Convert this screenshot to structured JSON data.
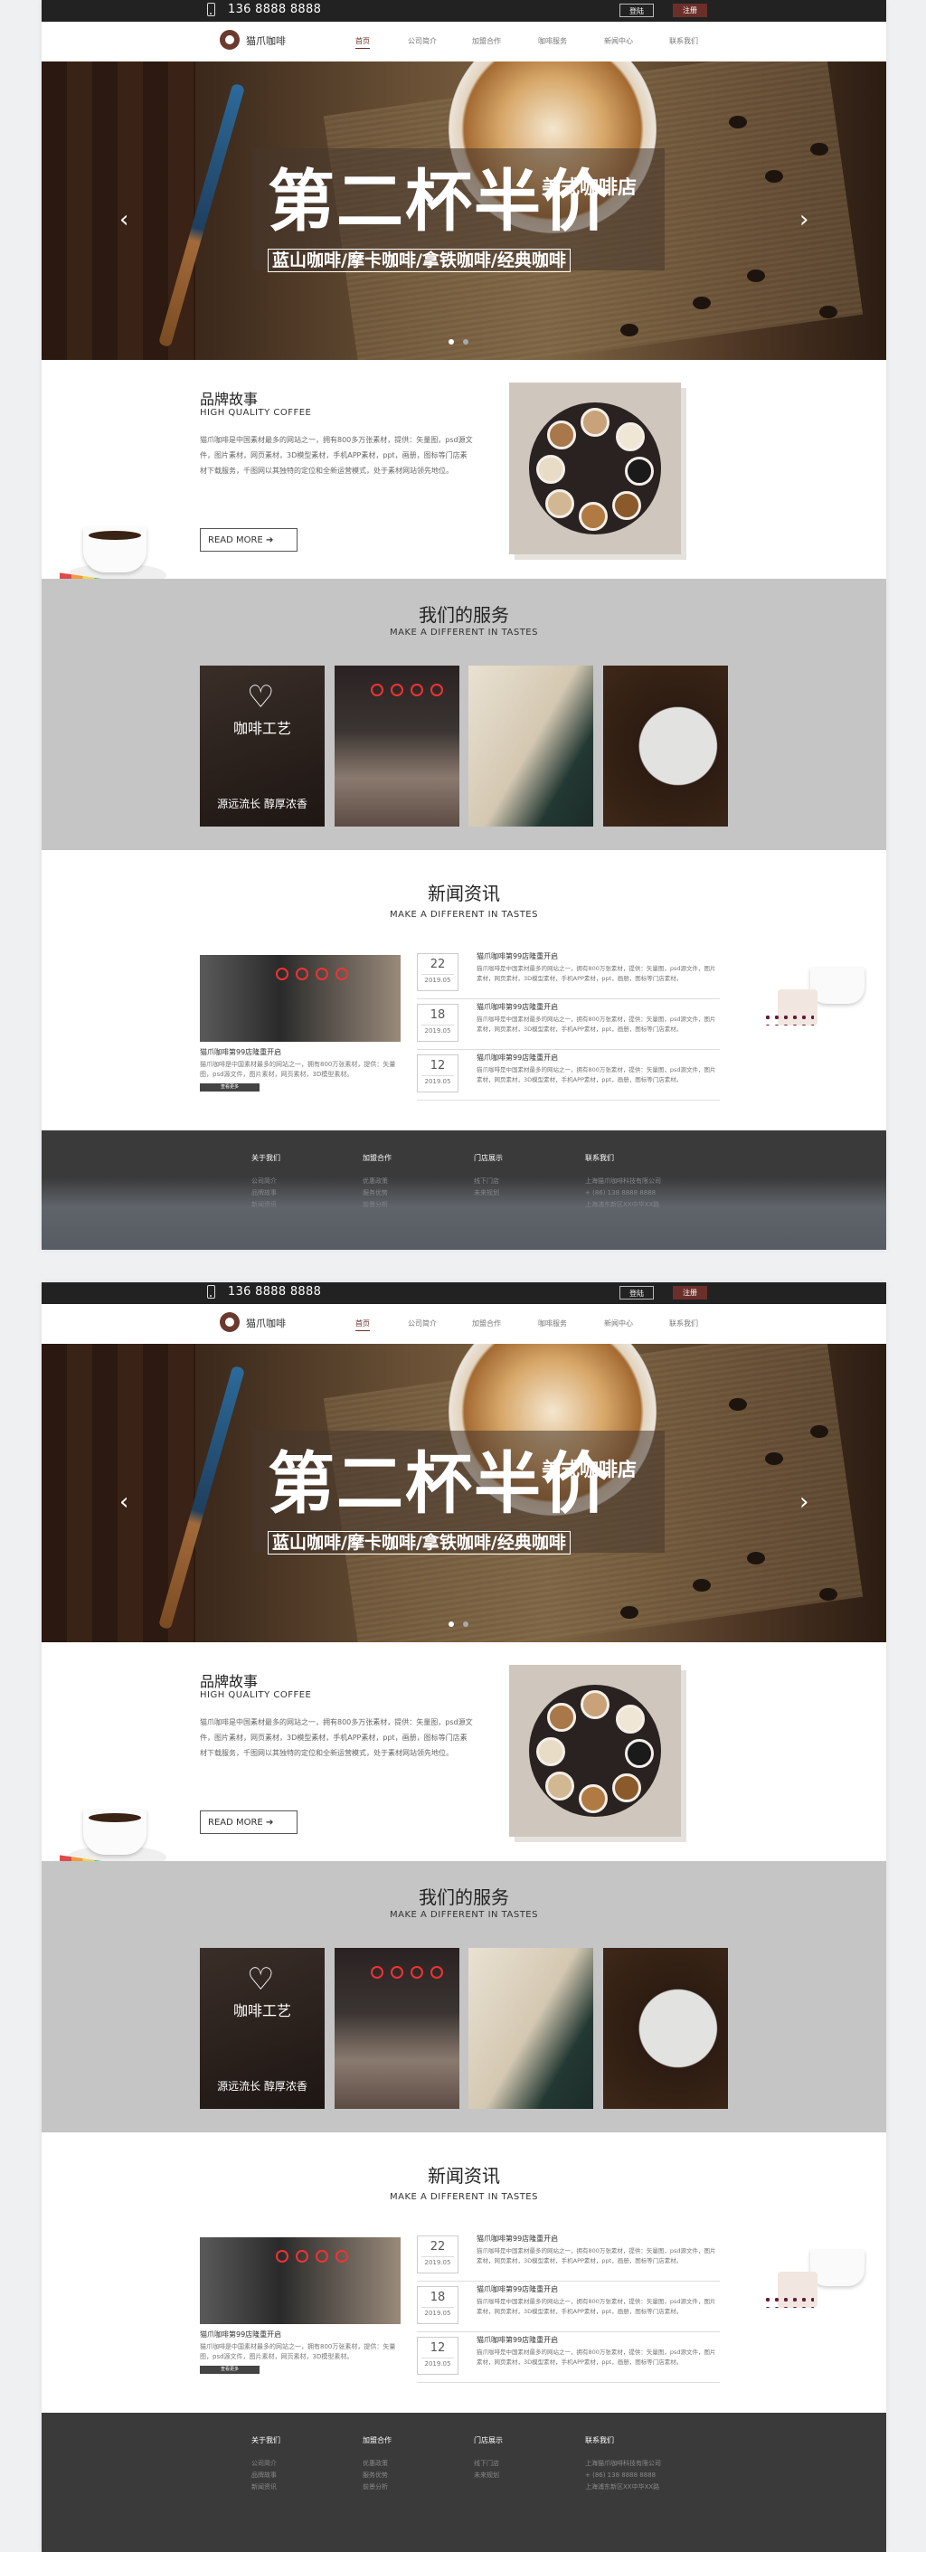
{
  "topbar": {
    "phone": "136 8888 8888",
    "login": "登陆",
    "register": "注册"
  },
  "nav": {
    "logo_text": "猫爪咖啡",
    "items": [
      "首页",
      "公司简介",
      "加盟合作",
      "咖啡服务",
      "新闻中心",
      "联系我们"
    ],
    "active_index": 0
  },
  "banner": {
    "title": "第二杯半价",
    "tag": "美式咖啡店",
    "subtitle": "蓝山咖啡/摩卡咖啡/拿铁咖啡/经典咖啡",
    "prev": "‹",
    "next": "›",
    "slide_count": 2,
    "active_slide": 0
  },
  "brand": {
    "title": "品牌故事",
    "subtitle": "HIGH QUALITY COFFEE",
    "text": "猫爪咖啡是中国素材最多的网站之一，拥有800多万张素材，提供：矢量图，psd源文件，图片素材，网页素材，3D模型素材，手机APP素材，ppt，画册，图标等门店素材下载服务，千图网以其独特的定位和全新运营模式，处于素材网站领先地位。",
    "read_more": "READ MORE"
  },
  "services": {
    "title": "我们的服务",
    "subtitle": "MAKE A DIFFERENT IN TASTES",
    "card_title": "咖啡工艺",
    "card_desc": "源远流长 醇厚浓香"
  },
  "news": {
    "title": "新闻资讯",
    "subtitle": "MAKE A DIFFERENT IN TASTES",
    "lead_title": "猫爪咖啡第99店隆重开启",
    "lead_text": "猫爪咖啡是中国素材最多的网站之一，拥有800万张素材，提供：矢量图，psd源文件，图片素材，网页素材，3D模型素材。",
    "more": "查看更多",
    "items": [
      {
        "day": "22",
        "ym": "2019.05",
        "title": "猫爪咖啡第99店隆重开启",
        "text": "猫爪咖啡是中国素材最多的网站之一，拥有800万张素材，提供：矢量图，psd源文件，图片素材，网页素材，3D模型素材，手机APP素材，ppt，画册，图标等门店素材。"
      },
      {
        "day": "18",
        "ym": "2019.05",
        "title": "猫爪咖啡第99店隆重开启",
        "text": "猫爪咖啡是中国素材最多的网站之一，拥有800万张素材，提供：矢量图，psd源文件，图片素材，网页素材，3D模型素材，手机APP素材，ppt，画册，图标等门店素材。"
      },
      {
        "day": "12",
        "ym": "2019.05",
        "title": "猫爪咖啡第99店隆重开启",
        "text": "猫爪咖啡是中国素材最多的网站之一，拥有800万张素材，提供：矢量图，psd源文件，图片素材，网页素材，3D模型素材，手机APP素材，ppt，画册，图标等门店素材。"
      }
    ]
  },
  "footer": {
    "columns": [
      {
        "heading": "关于我们",
        "links": [
          "公司简介",
          "品牌故事",
          "新闻资讯"
        ]
      },
      {
        "heading": "加盟合作",
        "links": [
          "优惠政策",
          "服务优势",
          "前景分析"
        ]
      },
      {
        "heading": "门店展示",
        "links": [
          "线下门店",
          "未来规划"
        ]
      },
      {
        "heading": "联系我们",
        "links": [
          "上海猫爪咖啡科技有限公司",
          "+ (86) 138 8888 8888",
          "上海浦东新区XX中华XX路"
        ]
      }
    ]
  },
  "colors": {
    "accent": "#6b2f2a",
    "dark": "#222222",
    "services_bg": "#c5c5c5",
    "footer_bg": "#3a3a3a"
  }
}
